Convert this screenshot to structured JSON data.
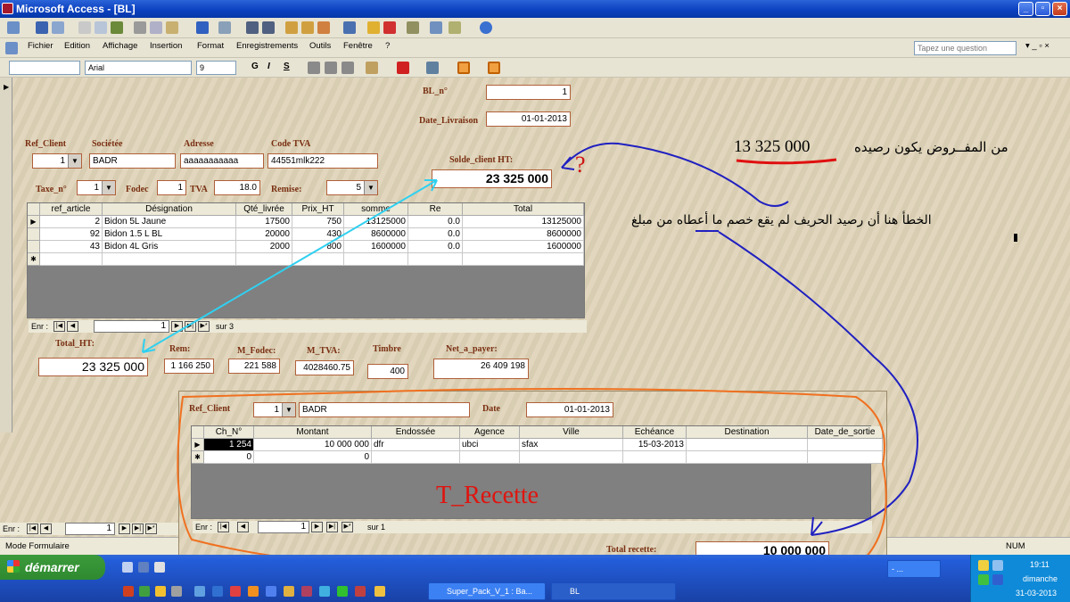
{
  "window": {
    "title": "Microsoft Access - [BL]"
  },
  "menubar": {
    "items": [
      "Fichier",
      "Edition",
      "Affichage",
      "Insertion",
      "Format",
      "Enregistrements",
      "Outils",
      "Fenêtre",
      "?"
    ],
    "help_placeholder": "Tapez une question"
  },
  "formatbar": {
    "font": "Arial",
    "size": "9",
    "bold": "G",
    "italic": "I",
    "underline": "S"
  },
  "form": {
    "bl_label": "BL_n°",
    "bl_value": "1",
    "date_label": "Date_Livraison",
    "date_value": "01-01-2013",
    "ref_client_label": "Ref_Client",
    "ref_client_value": "1",
    "societe_label": "Sociétée",
    "societe_value": "BADR",
    "adresse_label": "Adresse",
    "adresse_value": "aaaaaaaaaaa",
    "codetva_label": "Code TVA",
    "codetva_value": "44551mlk222",
    "solde_label": "Solde_client  HT:",
    "solde_value": "23 325 000",
    "taxe_label": "Taxe_n°",
    "taxe_value": "1",
    "fodec_label": "Fodec",
    "fodec_value": "1",
    "tva_label": "TVA",
    "tva_value": "18.0",
    "remise_label": "Remise:",
    "remise_value": "5"
  },
  "lines": {
    "columns": [
      "ref_article",
      "Désignation",
      "Qté_livrée",
      "Prix_HT",
      "somme",
      "Re",
      "Total"
    ],
    "rows": [
      [
        "2",
        "Bidon 5L Jaune",
        "17500",
        "750",
        "13125000",
        "0.0",
        "13125000"
      ],
      [
        "92",
        "Bidon 1.5 L BL",
        "20000",
        "430",
        "8600000",
        "0.0",
        "8600000"
      ],
      [
        "43",
        "Bidon 4L Gris",
        "2000",
        "800",
        "1600000",
        "0.0",
        "1600000"
      ]
    ],
    "nav": {
      "prefix": "Enr :",
      "current": "1",
      "suffix": "sur  3"
    }
  },
  "totals": {
    "total_ht_label": "Total_HT:",
    "total_ht_value": "23 325 000",
    "rem_label": "Rem:",
    "rem_value": "1 166 250",
    "mfodec_label": "M_Fodec:",
    "mfodec_value": "221 588",
    "mtva_label": "M_TVA:",
    "mtva_value": "4028460.75",
    "timbre_label": "Timbre",
    "timbre_value": "400",
    "net_label": "Net_a_payer:",
    "net_value": "26 409 198"
  },
  "main_nav": {
    "prefix": "Enr :",
    "current": "1"
  },
  "status": {
    "mode": "Mode Formulaire",
    "num": "NUM"
  },
  "recette": {
    "ref_client_label": "Ref_Client",
    "ref_client_value": "1",
    "societe_value": "BADR",
    "date_label": "Date",
    "date_value": "01-01-2013",
    "columns": [
      "Ch_N°",
      "Montant",
      "Endossée",
      "Agence",
      "Ville",
      "Echéance",
      "Destination",
      "Date_de_sortie"
    ],
    "rows": [
      [
        "1 254",
        "10 000 000",
        "dfr",
        "ubci",
        "sfax",
        "15-03-2013",
        "",
        ""
      ]
    ],
    "new_row": [
      "0",
      "0"
    ],
    "nav": {
      "prefix": "Enr :",
      "current": "1",
      "suffix": "sur  1"
    },
    "title": "T_Recette",
    "total_label": "Total recette:",
    "total_value": "10 000 000"
  },
  "annotations": {
    "expected": "من المفــروض يكون رصيده",
    "expected_value": "13 325 000",
    "question": "?",
    "error": "الخطأ هنا أن رصيد الحريف لم يقع خصم ما أعطاه من مبلغ"
  },
  "taskbar": {
    "start": "démarrer",
    "tasks": [
      "Super_Pack_V_1 : Ba...",
      "BL"
    ],
    "hidden_task": "- ...",
    "time": "19:11",
    "day": "dimanche",
    "date": "31-03-2013"
  }
}
